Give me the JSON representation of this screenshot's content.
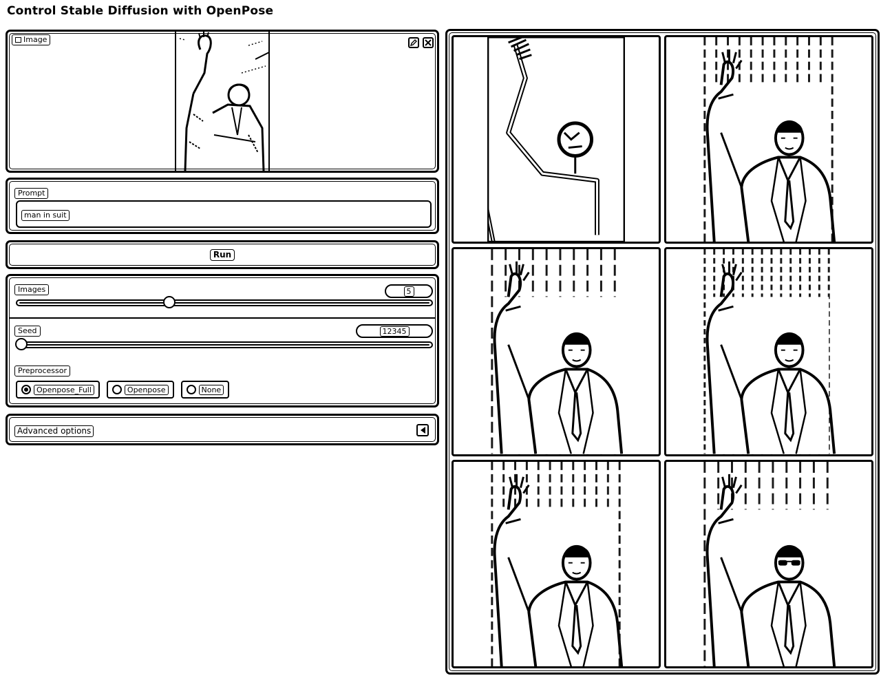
{
  "app": {
    "title": "Control Stable Diffusion with OpenPose"
  },
  "image_input": {
    "label": "Image",
    "icons": {
      "label_icon": "image-icon",
      "edit": "pencil-icon",
      "clear": "close-icon"
    }
  },
  "prompt": {
    "label": "Prompt",
    "value": "man in suit"
  },
  "run": {
    "label": "Run"
  },
  "controls": {
    "images": {
      "label": "Images",
      "value": "5",
      "min": 1,
      "max": 12,
      "current": 5
    },
    "seed": {
      "label": "Seed",
      "value": "12345",
      "min": 0,
      "max": 2147483647,
      "current": 12345
    },
    "preprocessor": {
      "label": "Preprocessor",
      "options": [
        "Openpose_Full",
        "Openpose",
        "None"
      ],
      "selected": "Openpose_Full"
    }
  },
  "advanced": {
    "label": "Advanced options",
    "icon": "collapse-arrow-icon"
  },
  "gallery": {
    "items": [
      {
        "kind": "pose-skeleton"
      },
      {
        "kind": "man-waving"
      },
      {
        "kind": "man-waving"
      },
      {
        "kind": "man-waving"
      },
      {
        "kind": "man-waving"
      },
      {
        "kind": "man-waving-sunglasses"
      }
    ]
  }
}
